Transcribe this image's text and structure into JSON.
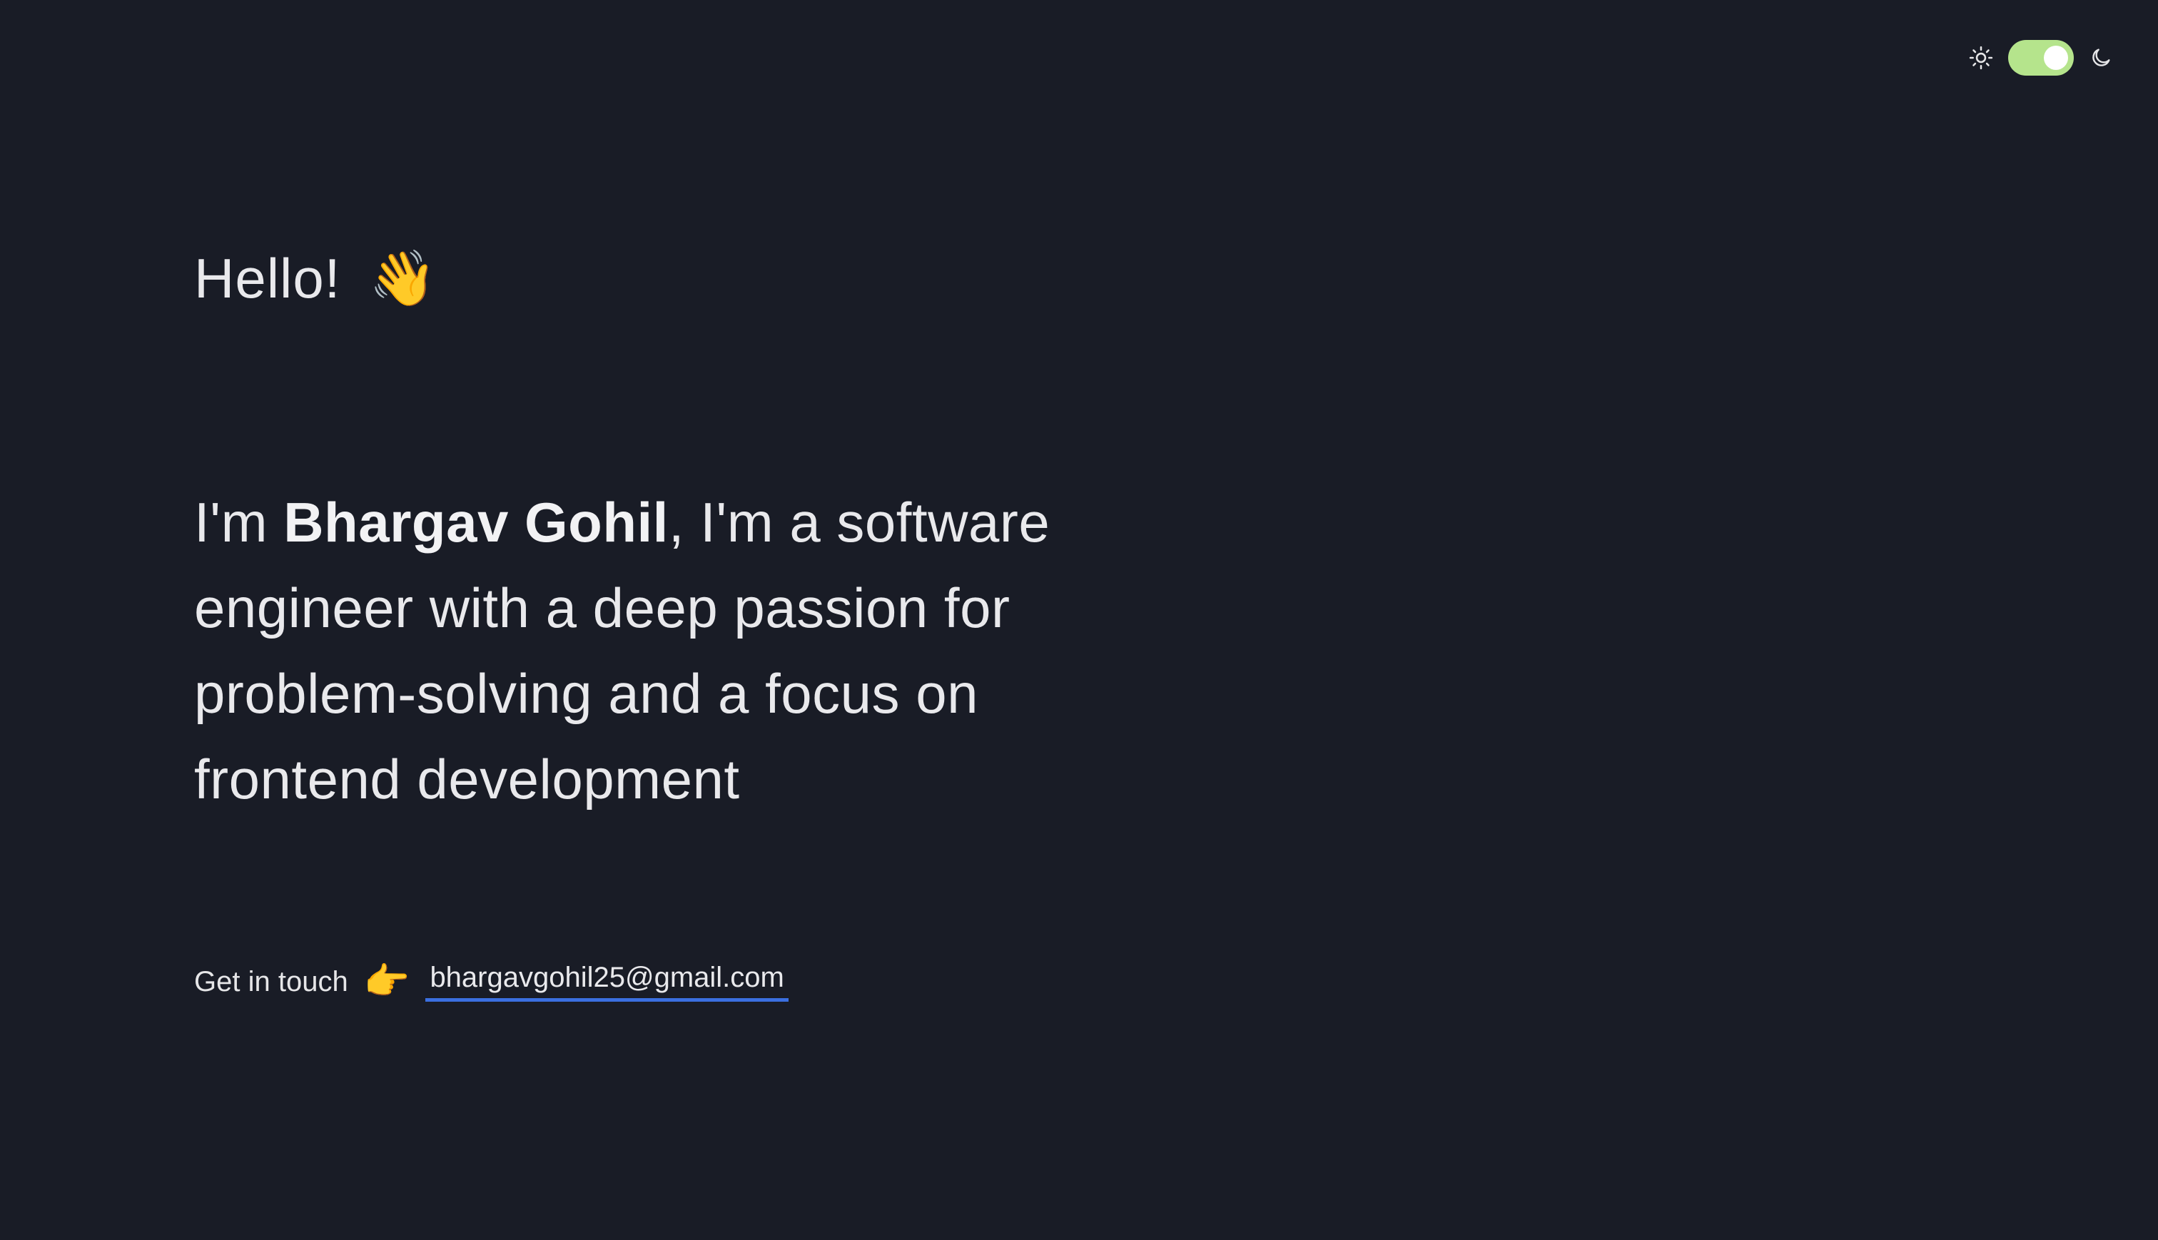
{
  "theme": {
    "toggle_on": true,
    "toggle_color": "#b5e48c",
    "light_icon": "sun-icon",
    "dark_icon": "moon-icon"
  },
  "hero": {
    "greeting": "Hello!",
    "greeting_emoji": "👋",
    "intro_prefix": "I'm ",
    "name": "Bhargav Gohil",
    "intro_suffix": ", I'm a software engineer with a deep passion for problem-solving and a focus on frontend development"
  },
  "contact": {
    "label": "Get in touch",
    "emoji": "👉",
    "email": "bhargavgohil25@gmail.com",
    "underline_color": "#3b6fe0"
  },
  "colors": {
    "background": "#191c26",
    "text": "#e9e9ec"
  }
}
